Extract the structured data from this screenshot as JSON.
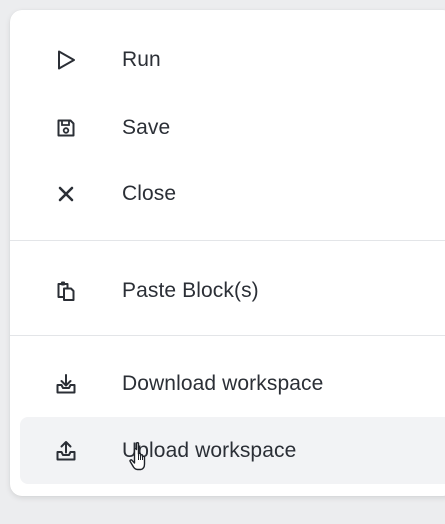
{
  "menu": {
    "items": [
      {
        "label": "Run",
        "icon": "play-outline-icon"
      },
      {
        "label": "Save",
        "icon": "save-icon"
      },
      {
        "label": "Close",
        "icon": "close-icon"
      },
      {
        "label": "Paste Block(s)",
        "icon": "paste-icon"
      },
      {
        "label": "Download workspace",
        "icon": "download-tray-icon"
      },
      {
        "label": "Upload workspace",
        "icon": "upload-tray-icon"
      }
    ],
    "hovered_item": "Upload workspace"
  },
  "colors": {
    "text": "#2b2f36",
    "icon": "#2b2f36",
    "divider": "#e3e5e8",
    "hover_background": "#f2f3f5",
    "menu_background": "#ffffff",
    "page_background": "#ecedef"
  }
}
